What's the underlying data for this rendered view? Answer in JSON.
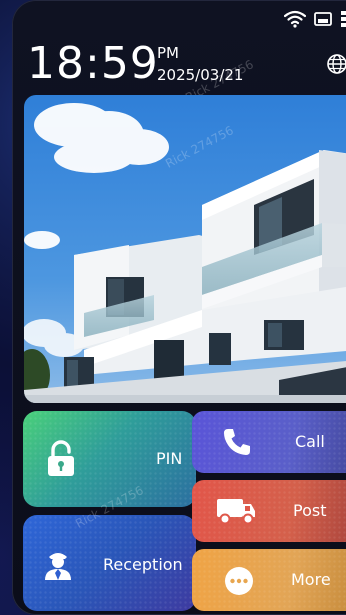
{
  "time": "18:59",
  "ampm": "PM",
  "date": "2025/03/21",
  "watermark": "Rick 274756",
  "tiles": {
    "pin": "PIN",
    "reception": "Reception",
    "call": "Call",
    "post": "Post",
    "more": "More"
  },
  "icons": {
    "wifi": "wifi-icon",
    "card": "sd-card-icon",
    "network": "network-icon",
    "globe": "globe-icon",
    "lock": "lock-icon",
    "person": "person-icon",
    "phone": "phone-icon",
    "truck": "truck-icon",
    "more": "more-icon"
  },
  "colors": {
    "pin": "#3fb38c",
    "reception": "#2e5fd0",
    "call": "#5a58d4",
    "post": "#df584a",
    "more": "#ecaa4e"
  }
}
